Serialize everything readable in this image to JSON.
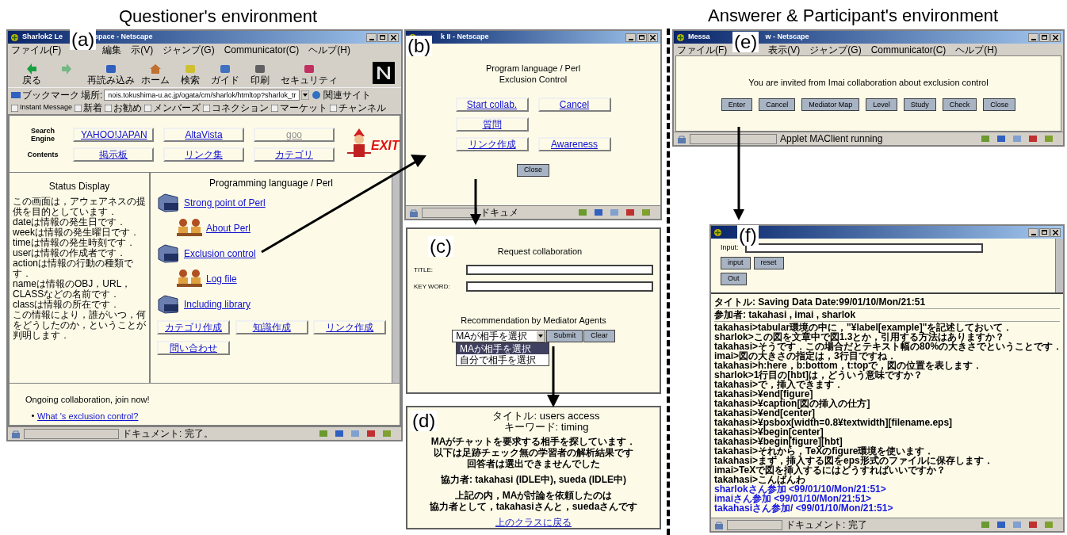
{
  "questioner_heading": "Questioner's environment",
  "answerer_heading": "Answerer & Participant's environment",
  "window_a": {
    "label": "(a)",
    "title_parts": [
      "Sharlok2 Le",
      "space - Netscape"
    ],
    "menu": [
      "ファイル(F)",
      "編集",
      "示(V)",
      "ジャンプ(G)",
      "Communicator(C)",
      "ヘルプ(H)"
    ],
    "toolbar": [
      "戻る",
      "再読み込み",
      "ホーム",
      "検索",
      "ガイド",
      "印刷",
      "セキュリティ"
    ],
    "bookmarks": "ブックマーク",
    "location_label": "場所:",
    "url": "nois.tokushima-u.ac.jp/ogata/cm/sharlok/htmltop?sharlok_tr",
    "related": "関連サイト",
    "personal": [
      "Instant Message",
      "新着",
      "お勧め",
      "メンバーズ",
      "コネクション",
      "マーケット",
      "チャンネル"
    ],
    "nav_rows": [
      {
        "heading": "Search Engine",
        "links": [
          {
            "text": "YAHOO!JAPAN",
            "disabled": false
          },
          {
            "text": "AltaVista",
            "disabled": false
          },
          {
            "text": "goo",
            "disabled": true
          }
        ]
      },
      {
        "heading": "Contents",
        "links": [
          {
            "text": "掲示板",
            "disabled": false
          },
          {
            "text": "リンク集",
            "disabled": false
          },
          {
            "text": "カテゴリ",
            "disabled": false
          }
        ]
      }
    ],
    "exit": "EXIT",
    "status_title": "Status Display",
    "status_lines": [
      "この画面は，アウェアネスの提供を目的としています．",
      "dateは情報の発生日です．",
      "weekは情報の発生曜日です．",
      "timeは情報の発生時刻です．",
      "userは情報の作成者です．",
      "actionは情報の行動の種類です．",
      "nameは情報のOBJ，URL，CLASSなどの名前です．",
      "classは情報の所在です．",
      "この情報により，誰がいつ，何をどうしたのか，ということが判明します．"
    ],
    "pane_title": "Programming language / Perl",
    "pane_items": [
      {
        "kind": "book",
        "text": "Strong point of Perl"
      },
      {
        "kind": "people",
        "text": "About Perl"
      },
      {
        "kind": "book",
        "text": "Exclusion control"
      },
      {
        "kind": "people",
        "text": "Log file"
      },
      {
        "kind": "book",
        "text": "Including library"
      }
    ],
    "pane_buttons": [
      "カテゴリ作成",
      "知識作成",
      "リンク作成",
      "問い合わせ"
    ],
    "ongoing": "Ongoing collaboration, join now!",
    "ongoing_link": "What 's exclusion control?",
    "status": "ドキュメント: 完了。"
  },
  "window_b": {
    "label": "(b)",
    "title": "k II - Netscape",
    "heading": [
      "Program language / Perl",
      "Exclusion Control"
    ],
    "buttons": [
      "Start collab.",
      "Cancel",
      "質問",
      "リンク作成",
      "Awareness"
    ],
    "close": "Close",
    "status": "ドキュメ"
  },
  "panel_c": {
    "label": "(c)",
    "title": "Request collaboration",
    "fields": [
      {
        "label": "TITLE:"
      },
      {
        "label": "KEY WORD:"
      }
    ],
    "recommend": "Recommendation by Mediator Agents",
    "select_value": "MAが相手を選択",
    "options": [
      {
        "text": "MAが相手を選択",
        "selected": true
      },
      {
        "text": "自分で相手を選択",
        "selected": false
      }
    ],
    "submit": "Submit",
    "clear": "Clear"
  },
  "panel_d": {
    "label": "(d)",
    "title": "タイトル: users access",
    "keyword": "キーワード: timing",
    "lines": [
      "MAがチャットを要求する相手を探しています．",
      "以下は足跡チェック無の学習者の解析結果です",
      "回答者は選出できませんでした",
      "協力者: takahasi (IDLE中), sueda (IDLE中)",
      "上記の内，MAが討論を依頼したのは",
      "協力者として，takahasiさんと，suedaさんです"
    ],
    "link": "上のクラスに戻る"
  },
  "window_e": {
    "label": "(e)",
    "title_parts": [
      "Messa",
      "w - Netscape"
    ],
    "menu": [
      "ファイル(F)",
      "表示(V)",
      "ジャンプ(G)",
      "Communicator(C)",
      "ヘルプ(H)"
    ],
    "message": "You are invited from Imai collaboration about exclusion control",
    "buttons": [
      "Enter",
      "Cancel",
      "Mediator Map",
      "Level",
      "Study",
      "Check",
      "Close"
    ],
    "status": "Applet MAClient running"
  },
  "window_f": {
    "label": "(f)",
    "input_label": "Input:",
    "buttons": [
      "input",
      "reset"
    ],
    "out": "Out",
    "title_line": "タイトル: Saving Data Date:99/01/10/Mon/21:51",
    "participants": "参加者: takahasi , imai , sharlok",
    "chat": [
      {
        "kind": "message",
        "text": "takahasi>tabular環境の中に，\"¥label[example]\"を記述しておいて．"
      },
      {
        "kind": "message",
        "text": "sharlok>この図を文章中で図1.3とか，引用する方法はありますか？"
      },
      {
        "kind": "message",
        "text": "takahasi>そうです．この場合だとテキスト幅の80%の大きさでということです．"
      },
      {
        "kind": "message",
        "text": "imai>図の大きさの指定は，3行目ですね．"
      },
      {
        "kind": "message",
        "text": "takahasi>h:here，b:bottom，t:topで，図の位置を表します．"
      },
      {
        "kind": "message",
        "text": "sharlok>1行目の[hbt]は，どういう意味ですか？"
      },
      {
        "kind": "message",
        "text": "takahasi>で，挿入できます．"
      },
      {
        "kind": "message",
        "text": "takahasi>¥end[figure]"
      },
      {
        "kind": "message",
        "text": "takahasi>¥caption[図の挿入の仕方]"
      },
      {
        "kind": "message",
        "text": "takahasi>¥end[center]"
      },
      {
        "kind": "message",
        "text": "takahasi>¥psbox[width=0.8¥textwidth][filename.eps]"
      },
      {
        "kind": "message",
        "text": "takahasi>¥begin[center]"
      },
      {
        "kind": "message",
        "text": "takahasi>¥begin[figure][hbt]"
      },
      {
        "kind": "message",
        "text": "takahasi>それから，TeXのfigure環境を使います．"
      },
      {
        "kind": "message",
        "text": "takahasi>まず，挿入する図をeps形式のファイルに保存します．"
      },
      {
        "kind": "message",
        "text": "imai>TeXで図を挿入するにはどうすればいいですか？"
      },
      {
        "kind": "message",
        "text": "takahasi>こんばんわ"
      },
      {
        "kind": "join",
        "text": "sharlokさん参加 <99/01/10/Mon/21:51>"
      },
      {
        "kind": "join",
        "text": "imaiさん参加 <99/01/10/Mon/21:51>"
      },
      {
        "kind": "join",
        "text": "takahasiさん参加/ <99/01/10/Mon/21:51>"
      }
    ],
    "status": "ドキュメント: 完了"
  }
}
